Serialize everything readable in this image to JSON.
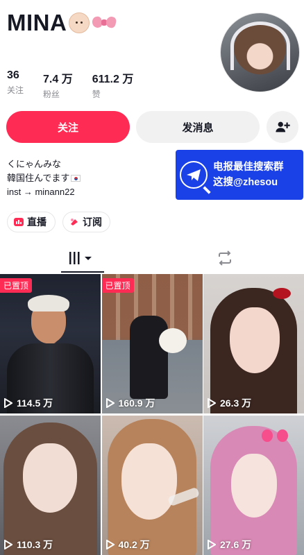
{
  "profile": {
    "name": "MINA",
    "emoji_icons": [
      "baby-face-icon",
      "pink-bow-icon"
    ]
  },
  "stats": [
    {
      "value": "36",
      "label": "关注"
    },
    {
      "value": "7.4 万",
      "label": "粉丝"
    },
    {
      "value": "611.2 万",
      "label": "赞"
    }
  ],
  "actions": {
    "follow_label": "关注",
    "message_label": "发消息",
    "add_friend_icon": "add-person-icon"
  },
  "bio": {
    "line1": "くにゃんみな",
    "line2": "韓国住んでます",
    "line3": "inst → minann22"
  },
  "ad": {
    "line1": "电报最佳搜索群",
    "line2": "这搜@zhesou"
  },
  "pills": {
    "live_label": "直播",
    "subscribe_label": "订阅"
  },
  "tabs": {
    "videos_icon": "grid-icon",
    "reposts_icon": "repost-icon"
  },
  "videos": [
    {
      "views": "114.5 万",
      "pinned": "已置顶"
    },
    {
      "views": "160.9 万",
      "pinned": "已置顶"
    },
    {
      "views": "26.3 万"
    },
    {
      "views": "110.3 万"
    },
    {
      "views": "40.2 万"
    },
    {
      "views": "27.6 万"
    }
  ],
  "colors": {
    "accent": "#fe2c55",
    "ad_blue": "#1a40e8",
    "button_gray": "#f1f1f2",
    "text": "#161823",
    "muted": "#8a8b91"
  }
}
